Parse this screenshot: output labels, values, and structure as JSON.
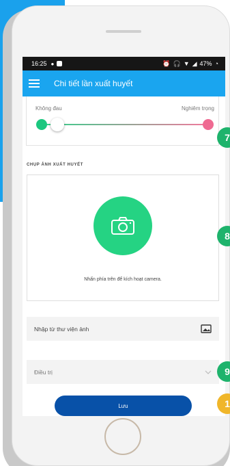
{
  "status_bar": {
    "time": "16:25",
    "battery": "47%"
  },
  "app_bar": {
    "title": "Chi tiết lần xuất huyết"
  },
  "pain_scale": {
    "min_label": "Không đau",
    "max_label": "Nghiêm trọng",
    "level": 0.08
  },
  "photo_section": {
    "title": "CHỤP ẢNH XUẤT HUYẾT",
    "hint": "Nhấn phía trên để kích hoạt camera."
  },
  "gallery": {
    "label": "Nhập từ thư viện ảnh"
  },
  "treatment": {
    "placeholder": "Điều trị"
  },
  "save_label": "Lưu",
  "badges": [
    "7",
    "8",
    "9",
    "1"
  ],
  "colors": {
    "accent": "#1aa5ef",
    "camera": "#25d383",
    "save": "#0851a8",
    "badge_green": "#1eb36c",
    "badge_yellow": "#f0b62a"
  }
}
